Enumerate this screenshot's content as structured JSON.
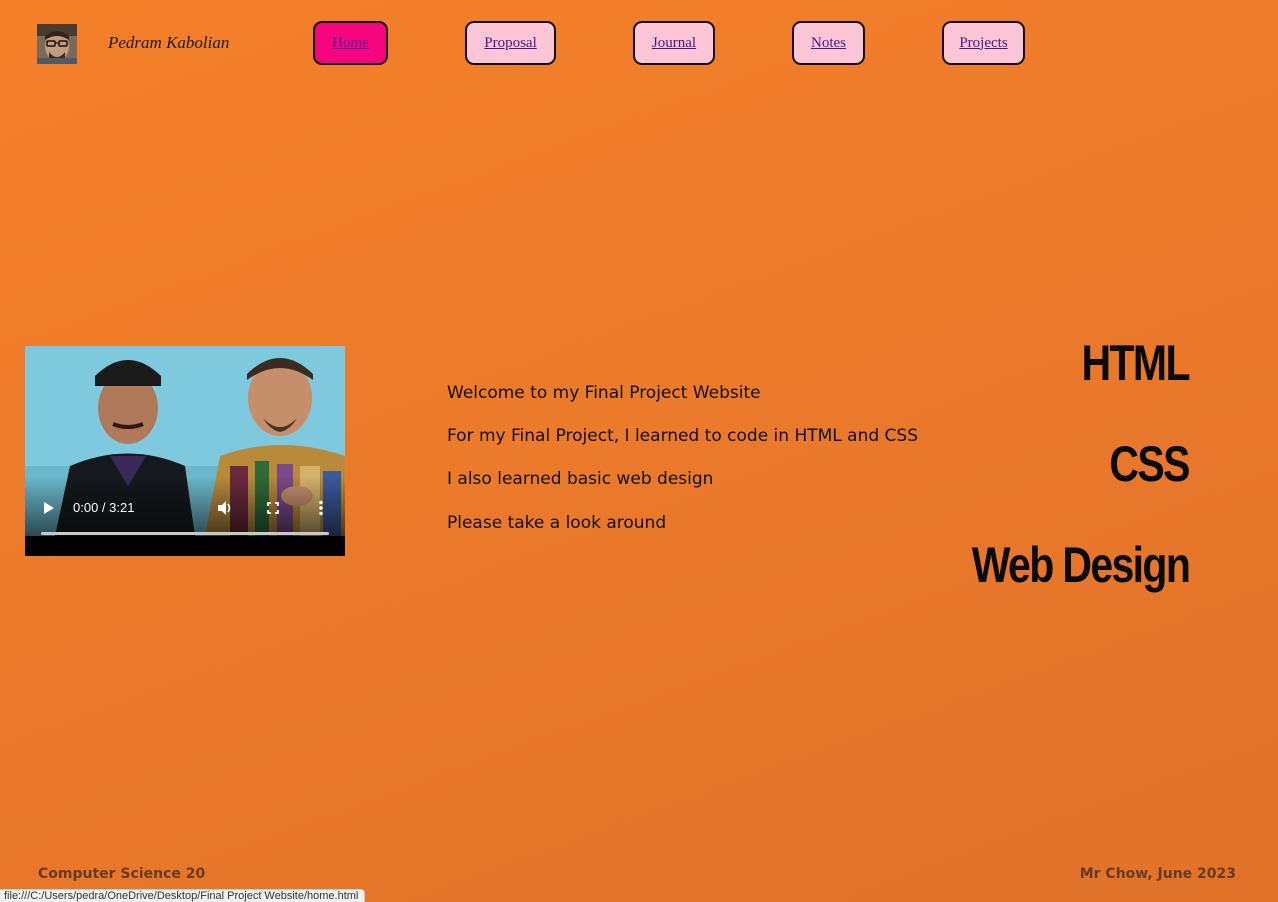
{
  "header": {
    "site_name": "Pedram Kabolian",
    "avatar_icon": "profile-photo"
  },
  "nav": {
    "items": [
      {
        "label": "Home ",
        "active": true
      },
      {
        "label": "Proposal ",
        "active": false
      },
      {
        "label": "Journal ",
        "active": false
      },
      {
        "label": "Notes ",
        "active": false
      },
      {
        "label": "Projects",
        "active": false
      }
    ],
    "active_color": "#f7057f",
    "inactive_color": "#fcc6d6"
  },
  "video": {
    "time_display": "0:00 / 3:21",
    "progress": 0,
    "controls": [
      "play-icon",
      "volume-icon",
      "fullscreen-icon",
      "more-options-icon"
    ]
  },
  "main": {
    "lines": [
      "Welcome to my Final Project Website",
      "For my Final Project, I learned to code in HTML and CSS",
      "I also learned basic web design",
      "Please take a look around"
    ]
  },
  "skills": [
    "HTML",
    "CSS",
    "Web Design"
  ],
  "footer": {
    "left": "Computer Science 20",
    "right": "Mr Chow, June 2023"
  },
  "status_bar": {
    "url": "file:///C:/Users/pedra/OneDrive/Desktop/Final Project Website/home.html"
  },
  "colors": {
    "background": "#f07c2a",
    "footer_text": "#6b3a1d"
  }
}
